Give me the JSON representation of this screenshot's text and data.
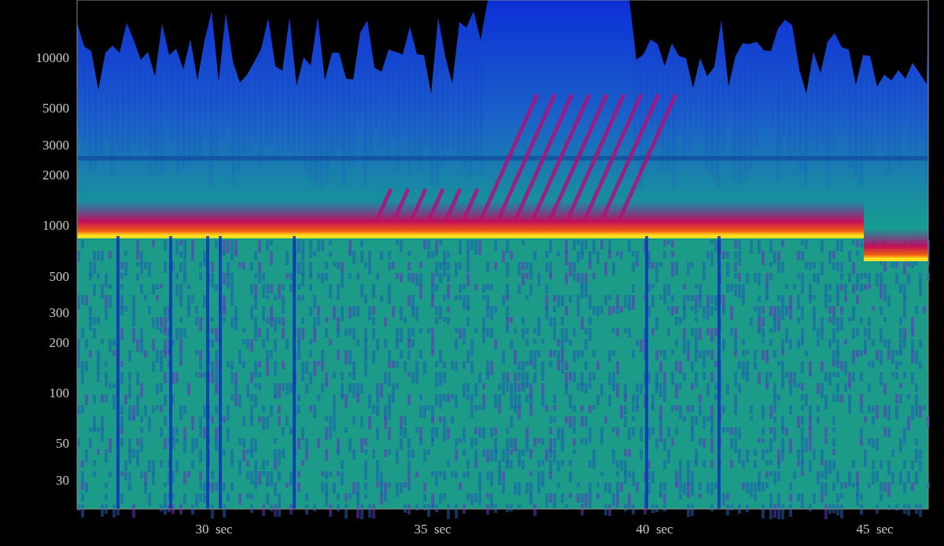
{
  "spectrogram": {
    "y_axis": {
      "tick_labels": [
        "10000",
        "5000",
        "3000",
        "2000",
        "1000",
        "500",
        "300",
        "200",
        "100",
        "50",
        "30"
      ]
    },
    "x_axis": {
      "tick_labels": [
        "30  sec",
        "35  sec",
        "40  sec",
        "45  sec"
      ]
    }
  }
}
